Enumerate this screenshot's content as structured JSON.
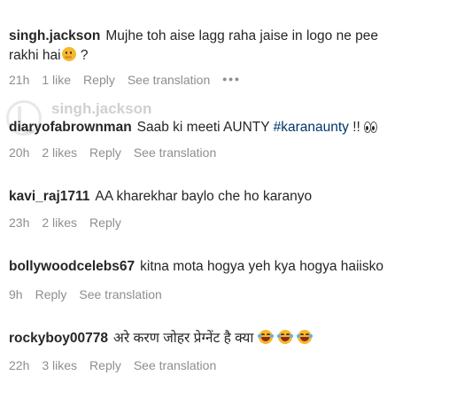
{
  "watermark": "singh.jackson",
  "comments": [
    {
      "username": "singh.jackson",
      "text": "Mujhe toh aise lagg raha jaise in logo ne pee",
      "text_cont": "rakhi hai",
      "text_end": " ?",
      "time": "21h",
      "likes": "1 like",
      "reply": "Reply",
      "translation": "See translation",
      "more": "•••"
    },
    {
      "username": "diaryofabrownman",
      "text": "Saab ki meeti AUNTY ",
      "hashtag": "#karanaunty",
      "text_end": " !!",
      "time": "20h",
      "likes": "2 likes",
      "reply": "Reply",
      "translation": "See translation"
    },
    {
      "username": "kavi_raj1711",
      "text": "AA kharekhar baylo che ho karanyo",
      "time": "23h",
      "likes": "2 likes",
      "reply": "Reply"
    },
    {
      "username": "bollywoodcelebs67",
      "text": "kitna mota hogya yeh kya hogya haiisko",
      "time": "9h",
      "reply": "Reply",
      "translation": "See translation"
    },
    {
      "username": "rockyboy00778",
      "text": "अरे करण जोहर प्रेग्नेंट है क्या",
      "time": "22h",
      "likes": "3 likes",
      "reply": "Reply",
      "translation": "See translation"
    }
  ]
}
